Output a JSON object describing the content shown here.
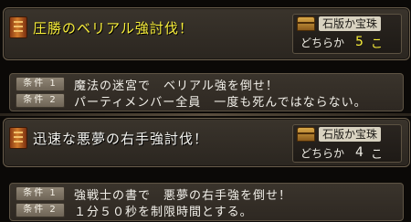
{
  "quests": [
    {
      "title": "圧勝のベリアル強討伐！",
      "reward": {
        "name": "石版か宝珠",
        "which": "どちらか",
        "count": "5",
        "unit": "こ"
      },
      "conditions": [
        {
          "badge": "条件 1",
          "text": "魔法の迷宮で　ベリアル強を倒せ！"
        },
        {
          "badge": "条件 2",
          "text": "パーティメンバー全員　一度も死んではならない。"
        }
      ]
    },
    {
      "title": "迅速な悪夢の右手強討伐！",
      "reward": {
        "name": "石版か宝珠",
        "which": "どちらか",
        "count": "4",
        "unit": "こ"
      },
      "conditions": [
        {
          "badge": "条件 1",
          "text": "強戦士の書で　悪夢の右手強を倒せ！"
        },
        {
          "badge": "条件 2",
          "text": "１分５０秒を制限時間とする。"
        }
      ]
    }
  ],
  "colors": {
    "highlight": "#f8ee3a",
    "text": "#f2f0ea",
    "panel": "#332d26"
  },
  "icons": {
    "quest": "scroll-icon",
    "reward": "chest-icon"
  }
}
